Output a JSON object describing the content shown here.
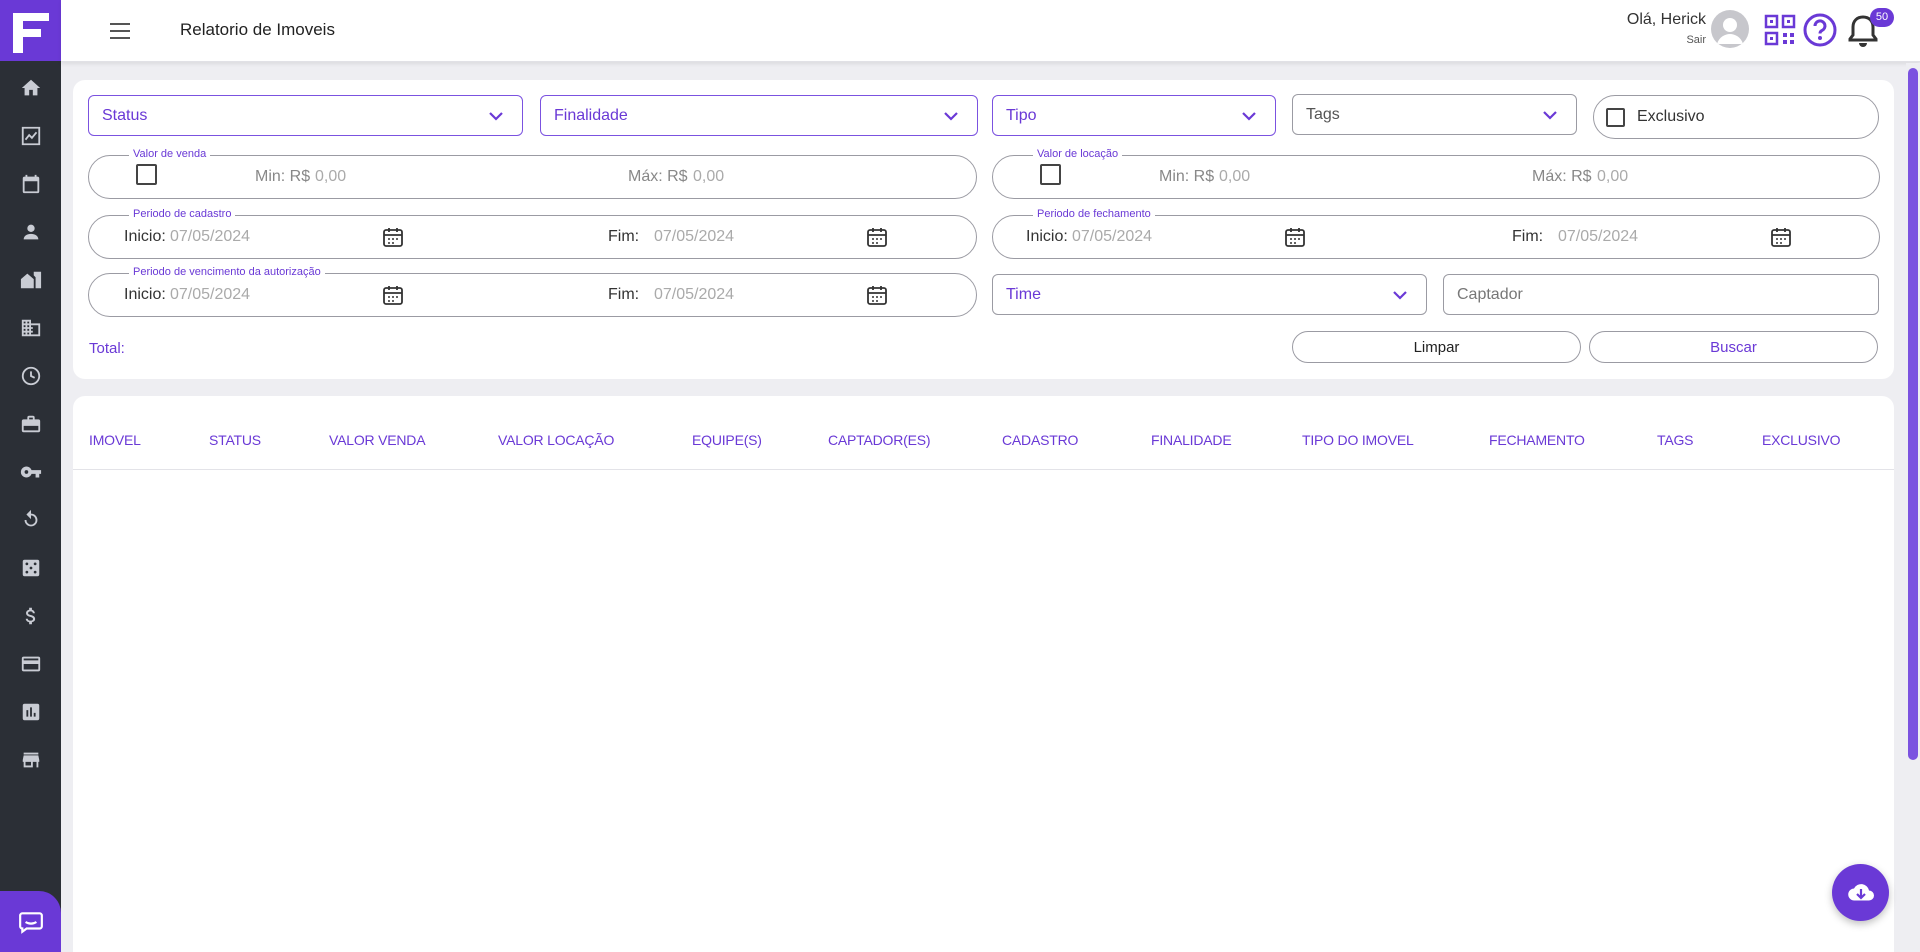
{
  "header": {
    "title": "Relatorio de Imoveis",
    "greeting": "Olá, Herick",
    "logout": "Sair",
    "notifications": "50"
  },
  "sidebar": {
    "items": [
      "home-icon",
      "chart-icon",
      "calendar-icon",
      "person-icon",
      "house-icon",
      "building-icon",
      "clock-icon",
      "briefcase-icon",
      "key-icon",
      "refresh-icon",
      "dice-icon",
      "dollar-icon",
      "card-icon",
      "bar-chart-icon",
      "store-icon"
    ]
  },
  "filters": {
    "status": "Status",
    "finalidade": "Finalidade",
    "tipo": "Tipo",
    "tags": "Tags",
    "exclusivo": "Exclusivo",
    "valor_venda": {
      "legend": "Valor de venda",
      "min_label": "Min: R$",
      "min_value": "0,00",
      "max_label": "Máx: R$",
      "max_value": "0,00"
    },
    "valor_locacao": {
      "legend": "Valor de locação",
      "min_label": "Min: R$",
      "min_value": "0,00",
      "max_label": "Máx: R$",
      "max_value": "0,00"
    },
    "periodo_cadastro": {
      "legend": "Periodo de cadastro",
      "inicio_label": "Inicio:",
      "inicio": "07/05/2024",
      "fim_label": "Fim:",
      "fim": "07/05/2024"
    },
    "periodo_fechamento": {
      "legend": "Periodo de fechamento",
      "inicio_label": "Inicio:",
      "inicio": "07/05/2024",
      "fim_label": "Fim:",
      "fim": "07/05/2024"
    },
    "periodo_vencimento": {
      "legend": "Periodo de vencimento da autorização",
      "inicio_label": "Inicio:",
      "inicio": "07/05/2024",
      "fim_label": "Fim:",
      "fim": "07/05/2024"
    },
    "time": "Time",
    "captador": "Captador",
    "total": "Total:",
    "limpar": "Limpar",
    "buscar": "Buscar"
  },
  "table": {
    "columns": [
      "IMOVEL",
      "STATUS",
      "VALOR VENDA",
      "VALOR LOCAÇÃO",
      "EQUIPE(S)",
      "CAPTADOR(ES)",
      "CADASTRO",
      "FINALIDADE",
      "TIPO DO IMOVEL",
      "FECHAMENTO",
      "TAGS",
      "EXCLUSIVO"
    ]
  },
  "colors": {
    "accent": "#6a39d6",
    "sidebar": "#2b2f36"
  }
}
